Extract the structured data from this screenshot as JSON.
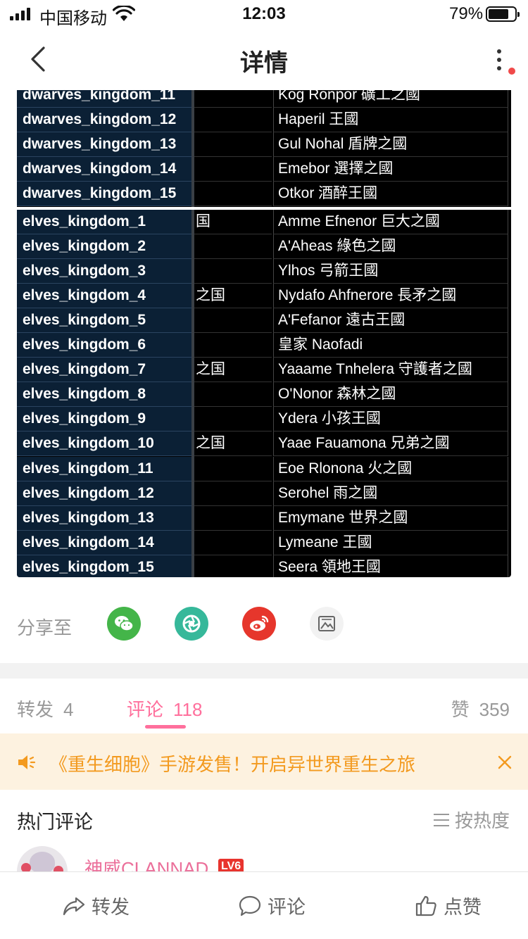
{
  "status_bar": {
    "carrier": "中国移动",
    "time": "12:03",
    "battery_percent": "79%"
  },
  "nav": {
    "title": "详情"
  },
  "image_table": {
    "rows": [
      {
        "key": "dwarves_kingdom_11",
        "mid": "",
        "value": "Kog Ronpor 礦工之國"
      },
      {
        "key": "dwarves_kingdom_12",
        "mid": "",
        "value": "Haperil 王國"
      },
      {
        "key": "dwarves_kingdom_13",
        "mid": "",
        "value": "Gul Nohal 盾牌之國"
      },
      {
        "key": "dwarves_kingdom_14",
        "mid": "",
        "value": "Emebor 選擇之國"
      },
      {
        "key": "dwarves_kingdom_15",
        "mid": "",
        "value": "Otkor 酒醉王國"
      },
      {
        "key": "elves_kingdom_1",
        "mid": "国",
        "value": "Amme Efnenor 巨大之國"
      },
      {
        "key": "elves_kingdom_2",
        "mid": "",
        "value": "A'Aheas 綠色之國"
      },
      {
        "key": "elves_kingdom_3",
        "mid": "",
        "value": "Ylhos 弓箭王國"
      },
      {
        "key": "elves_kingdom_4",
        "mid": "之国",
        "value": "Nydafo Ahfnerore 長矛之國"
      },
      {
        "key": "elves_kingdom_5",
        "mid": "",
        "value": "A'Fefanor 遠古王國"
      },
      {
        "key": "elves_kingdom_6",
        "mid": "",
        "value": "皇家 Naofadi"
      },
      {
        "key": "elves_kingdom_7",
        "mid": "之国",
        "value": "Yaaame Tnhelera 守護者之國"
      },
      {
        "key": "elves_kingdom_8",
        "mid": "",
        "value": "O'Nonor 森林之國"
      },
      {
        "key": "elves_kingdom_9",
        "mid": "",
        "value": "Ydera 小孩王國"
      },
      {
        "key": "elves_kingdom_10",
        "mid": "之国",
        "value": "Yaae Fauamona 兄弟之國"
      },
      {
        "key": "elves_kingdom_11",
        "mid": "",
        "value": "Eoe Rlonona 火之國"
      },
      {
        "key": "elves_kingdom_12",
        "mid": "",
        "value": "Serohel 雨之國"
      },
      {
        "key": "elves_kingdom_13",
        "mid": "",
        "value": "Emymane 世界之國"
      },
      {
        "key": "elves_kingdom_14",
        "mid": "",
        "value": "Lymeane 王國"
      },
      {
        "key": "elves_kingdom_15",
        "mid": "",
        "value": "Seera 領地王國"
      }
    ]
  },
  "share": {
    "label": "分享至",
    "targets": [
      "wechat-icon",
      "moments-icon",
      "weibo-icon",
      "album-icon"
    ]
  },
  "tabs": {
    "repost_label": "转发",
    "repost_count": "4",
    "comment_label": "评论",
    "comment_count": "118",
    "like_label": "赞",
    "like_count": "359",
    "active_color": "#ff6f9c"
  },
  "notice": {
    "text": "《重生细胞》手游发售！开启异世界重生之旅",
    "color": "#f39a1f"
  },
  "hot_comments": {
    "title": "热门评论",
    "sort_label": "按热度",
    "first_user": "神威CLANNAD",
    "first_badge": "LV6"
  },
  "bottom_bar": {
    "repost": "转发",
    "comment": "评论",
    "like": "点赞"
  }
}
